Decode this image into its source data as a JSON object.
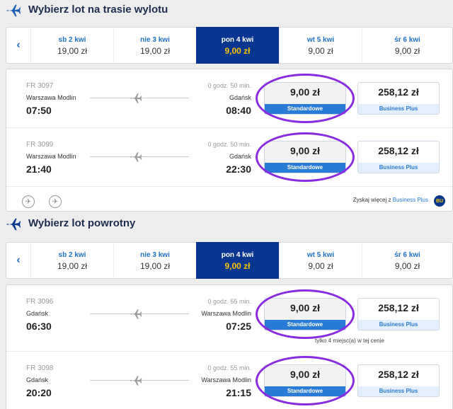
{
  "outbound": {
    "title": "Wybierz lot na trasie wylotu",
    "dates": [
      {
        "day": "sb 2 kwi",
        "price": "19,00 zł"
      },
      {
        "day": "nie 3 kwi",
        "price": "19,00 zł"
      },
      {
        "day": "pon 4 kwi",
        "price": "9,00 zł",
        "active": true
      },
      {
        "day": "wt 5 kwi",
        "price": "9,00 zł"
      },
      {
        "day": "śr 6 kwi",
        "price": "9,00 zł"
      }
    ],
    "flights": [
      {
        "number": "FR 3097",
        "from": "Warszawa Modlin",
        "dep": "07:50",
        "duration": "0 godz. 50 min.",
        "to": "Gdańsk",
        "arr": "08:40",
        "std_price": "9,00 zł",
        "std_label": "Standardowe",
        "bus_price": "258,12 zł",
        "bus_label": "Business Plus"
      },
      {
        "number": "FR 3099",
        "from": "Warszawa Modlin",
        "dep": "21:40",
        "duration": "0 godz. 50 min.",
        "to": "Gdańsk",
        "arr": "22:30",
        "std_price": "9,00 zł",
        "std_label": "Standardowe",
        "bus_price": "258,12 zł",
        "bus_label": "Business Plus"
      }
    ],
    "promo_text": "Zyskaj więcej z",
    "promo_link": "Business Plus",
    "badge_text": "BU"
  },
  "return": {
    "title": "Wybierz lot powrotny",
    "dates": [
      {
        "day": "sb 2 kwi",
        "price": "19,00 zł"
      },
      {
        "day": "nie 3 kwi",
        "price": "19,00 zł"
      },
      {
        "day": "pon 4 kwi",
        "price": "9,00 zł",
        "active": true
      },
      {
        "day": "wt 5 kwi",
        "price": "9,00 zł"
      },
      {
        "day": "śr 6 kwi",
        "price": "9,00 zł"
      }
    ],
    "flights": [
      {
        "number": "FR 3096",
        "from": "Gdańsk",
        "dep": "06:30",
        "duration": "0 godz. 55 min.",
        "to": "Warszawa Modlin",
        "arr": "07:25",
        "std_price": "9,00 zł",
        "std_label": "Standardowe",
        "bus_price": "258,12 zł",
        "bus_label": "Business Plus"
      },
      {
        "number": "FR 3098",
        "from": "Gdańsk",
        "dep": "20:20",
        "duration": "0 godz. 55 min.",
        "to": "Warszawa Modlin",
        "arr": "21:15",
        "std_price": "9,00 zł",
        "std_label": "Standardowe",
        "bus_price": "258,12 zł",
        "bus_label": "Business Plus"
      }
    ],
    "seat_note": "tylko 4 miejsc(a) w tej cenie"
  },
  "nav_prev_symbol": "‹",
  "icons": {
    "section_icon": "plane-icon",
    "row_icon": "plane-icon",
    "no_fly_icon": "plane-crossed-icon"
  },
  "colors": {
    "brand_navy": "#073590",
    "accent_yellow": "#f6c500",
    "link_blue": "#2a7bd6",
    "highlight_ring": "#8a2be2"
  }
}
